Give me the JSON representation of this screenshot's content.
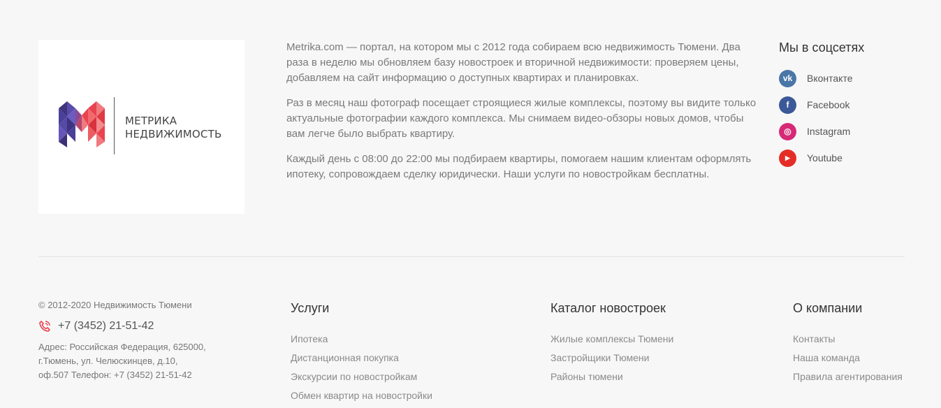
{
  "logo": {
    "line1": "МЕТРИКА",
    "line2": "НЕДВИЖИМОСТЬ",
    "colors": {
      "purple": "#4b3f9a",
      "red": "#e8434e",
      "pink": "#f07a7f"
    }
  },
  "about": {
    "paragraphs": [
      "Metrika.com — портал, на котором мы с 2012 года собираем всю недвижимость Тюмени. Два раза в неделю мы обновляем базу новостроек и вторичной недвижимости: проверяем цены, добавляем на сайт информацию о доступных квартирах и планировках.",
      "Раз в месяц наш фотограф посещает строящиеся жилые комплексы, поэтому вы видите только актуальные фотографии каждого комплекса. Мы снимаем видео-обзоры новых домов, чтобы вам легче было выбрать квартиру.",
      "Каждый день с 08:00 до 22:00 мы подбираем квартиры, помогаем нашим клиентам оформлять ипотеку, сопровождаем сделку юридически. Наши услуги по новостройкам бесплатны."
    ]
  },
  "social": {
    "title": "Мы в соцсетях",
    "items": [
      {
        "label": "Вконтакте",
        "icon": "vk-icon",
        "glyph": "vk",
        "color": "#4a76a8"
      },
      {
        "label": "Facebook",
        "icon": "facebook-icon",
        "glyph": "f",
        "color": "#3b5998"
      },
      {
        "label": "Instagram",
        "icon": "instagram-icon",
        "glyph": "◎",
        "color": "#d62976"
      },
      {
        "label": "Youtube",
        "icon": "youtube-icon",
        "glyph": "▶",
        "color": "#e52d27"
      }
    ]
  },
  "contacts": {
    "copyright": "© 2012-2020 Недвижимость Тюмени",
    "phone": "+7 (3452) 21-51-42",
    "address": "Адрес: Российская Федерация, 625000, г.Тюмень, ул. Челюскинцев, д.10, оф.507 Телефон: +7 (3452) 21-51-42",
    "phone_icon_color": "#e8434e"
  },
  "columns": [
    {
      "title": "Услуги",
      "links": [
        "Ипотека",
        "Дистанционная покупка",
        "Экскурсии по новостройкам",
        "Обмен квартир на новостройки"
      ]
    },
    {
      "title": "Каталог новостроек",
      "links": [
        "Жилые комплексы Тюмени",
        "Застройщики Тюмени",
        "Районы тюмени"
      ]
    },
    {
      "title": "О компании",
      "links": [
        "Контакты",
        "Наша команда",
        "Правила агентирования"
      ]
    }
  ]
}
